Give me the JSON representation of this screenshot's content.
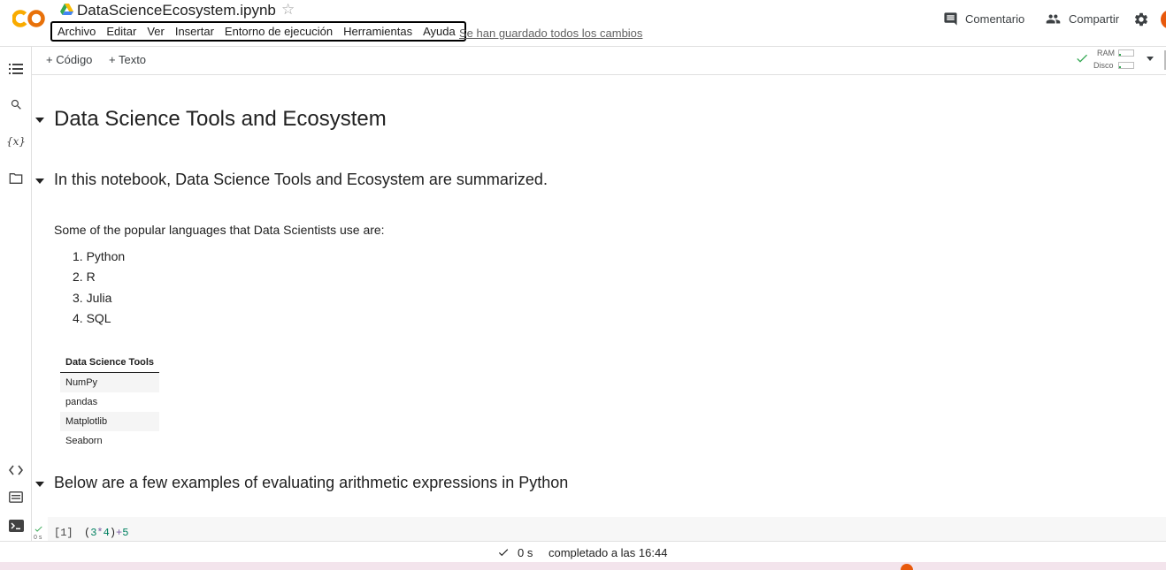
{
  "header": {
    "title": "DataScienceEcosystem.ipynb",
    "menu": [
      "Archivo",
      "Editar",
      "Ver",
      "Insertar",
      "Entorno de ejecución",
      "Herramientas",
      "Ayuda"
    ],
    "saved_status": "Se han guardado todos los cambios",
    "comment_label": "Comentario",
    "share_label": "Compartir"
  },
  "toolbar": {
    "add_code": "+ Código",
    "add_text": "+ Texto",
    "ram_label": "RAM",
    "disk_label": "Disco",
    "ram_usage": 0.15,
    "disk_usage": 0.15
  },
  "sidebar_icons": [
    "table-of-contents-icon",
    "search-icon",
    "variables-icon",
    "files-icon",
    "code-snippets-icon",
    "command-palette-icon",
    "terminal-icon"
  ],
  "notebook": {
    "heading1": "Data Science Tools and Ecosystem",
    "heading2": "In this notebook, Data Science Tools and Ecosystem are summarized.",
    "languages_intro": "Some of the popular languages that Data Scientists use are:",
    "languages": [
      "1. Python",
      "2. R",
      "3. Julia",
      "4. SQL"
    ],
    "tools_table": {
      "header": "Data Science Tools",
      "rows": [
        "NumPy",
        "pandas",
        "Matplotlib",
        "Seaborn"
      ]
    },
    "heading3": "Below are a few examples of evaluating arithmetic expressions in Python",
    "code_cell": {
      "prompt": "[1]",
      "code_open": "(",
      "code_a": "3",
      "code_op1": "*",
      "code_b": "4",
      "code_close": ")",
      "code_op2": "+",
      "code_c": "5",
      "exec_time": "0 s"
    }
  },
  "status_bar": {
    "time": "0 s",
    "message": "completado a las 16:44"
  },
  "colors": {
    "logo_orange": "#f9ab00",
    "logo_dark": "#e8710a",
    "ok_green": "#34a853"
  }
}
